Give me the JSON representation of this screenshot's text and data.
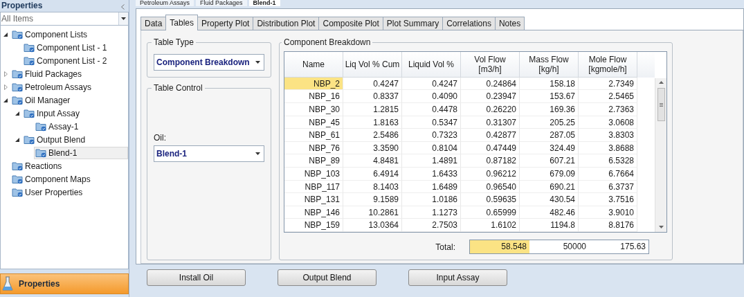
{
  "sidebar": {
    "title": "Properties",
    "filter": {
      "value": "All Items"
    },
    "tree": [
      {
        "label": "Component Lists",
        "expanded": true,
        "selected": false,
        "children": [
          {
            "label": "Component List - 1",
            "selected": false
          },
          {
            "label": "Component List - 2",
            "selected": false
          }
        ]
      },
      {
        "label": "Fluid Packages",
        "expanded": false,
        "selected": false
      },
      {
        "label": "Petroleum Assays",
        "expanded": false,
        "selected": false
      },
      {
        "label": "Oil Manager",
        "expanded": true,
        "selected": false,
        "children": [
          {
            "label": "Input Assay",
            "expanded": true,
            "selected": false,
            "children": [
              {
                "label": "Assay-1",
                "selected": false
              }
            ]
          },
          {
            "label": "Output Blend",
            "expanded": true,
            "selected": false,
            "children": [
              {
                "label": "Blend-1",
                "selected": true
              }
            ]
          }
        ]
      },
      {
        "label": "Reactions",
        "selected": false
      },
      {
        "label": "Component Maps",
        "selected": false
      },
      {
        "label": "User Properties",
        "selected": false
      }
    ],
    "footer": {
      "label": "Properties"
    }
  },
  "document_tabs": [
    {
      "label": "Petroleum Assays",
      "selected": false
    },
    {
      "label": "Fluid Packages",
      "selected": false
    },
    {
      "label": "Blend-1",
      "selected": true
    }
  ],
  "tabs": [
    {
      "label": "Data",
      "selected": false
    },
    {
      "label": "Tables",
      "selected": true
    },
    {
      "label": "Property Plot",
      "selected": false
    },
    {
      "label": "Distribution Plot",
      "selected": false
    },
    {
      "label": "Composite Plot",
      "selected": false
    },
    {
      "label": "Plot Summary",
      "selected": false
    },
    {
      "label": "Correlations",
      "selected": false
    },
    {
      "label": "Notes",
      "selected": false
    }
  ],
  "table_type": {
    "title": "Table Type",
    "value": "Component Breakdown"
  },
  "table_control": {
    "title": "Table Control",
    "oil_label": "Oil:",
    "oil_value": "Blend-1"
  },
  "breakdown": {
    "title": "Component Breakdown",
    "columns": [
      "Name",
      "Liq Vol % Cum",
      "Liquid  Vol %",
      "Vol Flow\n[m3/h]",
      "Mass Flow\n[kg/h]",
      "Mole Flow\n[kgmole/h]"
    ],
    "rows": [
      {
        "selected": true,
        "cells": [
          "NBP_2",
          "0.4247",
          "0.4247",
          "0.24864",
          "158.18",
          "2.7349"
        ]
      },
      {
        "selected": false,
        "cells": [
          "NBP_16",
          "0.8337",
          "0.4090",
          "0.23947",
          "153.67",
          "2.5465"
        ]
      },
      {
        "selected": false,
        "cells": [
          "NBP_30",
          "1.2815",
          "0.4478",
          "0.26220",
          "169.36",
          "2.7363"
        ]
      },
      {
        "selected": false,
        "cells": [
          "NBP_45",
          "1.8163",
          "0.5347",
          "0.31307",
          "205.25",
          "3.0608"
        ]
      },
      {
        "selected": false,
        "cells": [
          "NBP_61",
          "2.5486",
          "0.7323",
          "0.42877",
          "287.05",
          "3.8303"
        ]
      },
      {
        "selected": false,
        "cells": [
          "NBP_76",
          "3.3590",
          "0.8104",
          "0.47449",
          "324.49",
          "3.8688"
        ]
      },
      {
        "selected": false,
        "cells": [
          "NBP_89",
          "4.8481",
          "1.4891",
          "0.87182",
          "607.21",
          "6.5328"
        ]
      },
      {
        "selected": false,
        "cells": [
          "NBP_103",
          "6.4914",
          "1.6433",
          "0.96212",
          "679.09",
          "6.7664"
        ]
      },
      {
        "selected": false,
        "cells": [
          "NBP_117",
          "8.1403",
          "1.6489",
          "0.96540",
          "690.21",
          "6.3737"
        ]
      },
      {
        "selected": false,
        "cells": [
          "NBP_131",
          "9.1589",
          "1.0186",
          "0.59635",
          "430.54",
          "3.7516"
        ]
      },
      {
        "selected": false,
        "cells": [
          "NBP_146",
          "10.2861",
          "1.1273",
          "0.65999",
          "482.46",
          "3.9010"
        ]
      },
      {
        "selected": false,
        "cells": [
          "NBP_159",
          "13.0364",
          "2.7503",
          "1.6102",
          "1194.8",
          "8.8176"
        ]
      }
    ],
    "total_label": "Total:",
    "totals": [
      {
        "value": "58.548",
        "highlighted": true
      },
      {
        "value": "50000",
        "highlighted": false
      },
      {
        "value": "175.63",
        "highlighted": false
      }
    ]
  },
  "buttons": [
    "Install Oil",
    "Output Blend",
    "Input Assay"
  ]
}
